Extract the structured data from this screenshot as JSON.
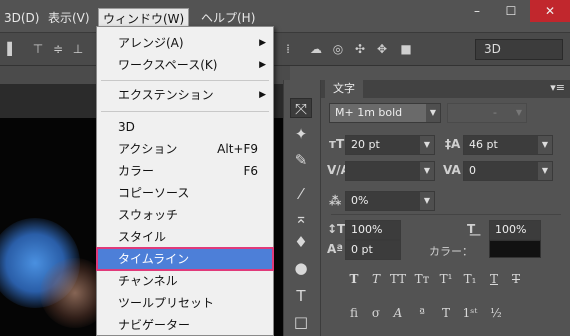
{
  "menubar": {
    "items": [
      "3D(D)",
      "表示(V)",
      "ウィンドウ(W)",
      "ヘルプ(H)"
    ],
    "window_controls": [
      "–",
      "☐",
      "✕"
    ]
  },
  "optionsbar": {
    "mode_select": "3D"
  },
  "dropdown": {
    "group1": [
      {
        "label": "アレンジ(A)",
        "submenu": true
      },
      {
        "label": "ワークスペース(K)",
        "submenu": true
      }
    ],
    "group2": [
      {
        "label": "エクステンション",
        "submenu": true
      }
    ],
    "group3": [
      {
        "label": "3D",
        "shortcut": ""
      },
      {
        "label": "アクション",
        "shortcut": "Alt+F9"
      },
      {
        "label": "カラー",
        "shortcut": "F6"
      },
      {
        "label": "コピーソース",
        "shortcut": ""
      },
      {
        "label": "スウォッチ",
        "shortcut": ""
      },
      {
        "label": "スタイル",
        "shortcut": ""
      },
      {
        "label": "タイムライン",
        "shortcut": ""
      },
      {
        "label": "チャンネル",
        "shortcut": ""
      },
      {
        "label": "ツールプリセット",
        "shortcut": ""
      },
      {
        "label": "ナビゲーター",
        "shortcut": ""
      }
    ],
    "highlighted": "タイムライン"
  },
  "panel": {
    "tab": "文字",
    "font_family": "M+ 1m bold",
    "font_style": "-",
    "font_size": "20 pt",
    "leading": "46 pt",
    "kerning": "",
    "tracking": "0",
    "tsume": "0%",
    "vertical_scale": "100%",
    "horizontal_scale": "100%",
    "baseline_shift": "0 pt",
    "color_label": "カラー：",
    "color_value": "#111111"
  },
  "colors": {
    "highlight_bg": "#4d7fd8",
    "highlight_border": "#e03a7a",
    "close_button": "#c1272d"
  }
}
